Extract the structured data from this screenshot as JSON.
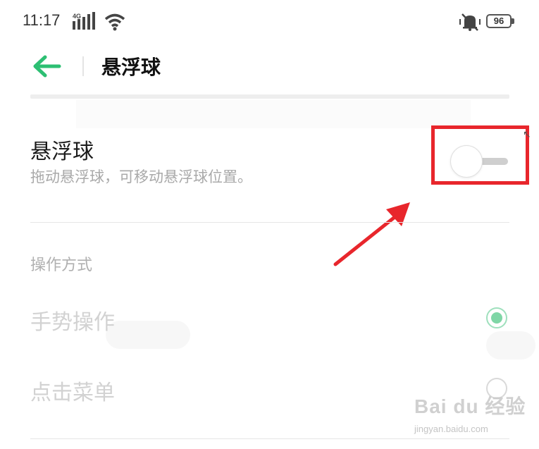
{
  "status_bar": {
    "time": "11:17",
    "network_icon": "4g-signal-icon",
    "wifi_icon": "wifi-icon",
    "mute_icon": "silent-mode-icon",
    "battery_level": "96"
  },
  "header": {
    "back_icon": "back-arrow-icon",
    "title": "悬浮球"
  },
  "floating_ball": {
    "title": "悬浮球",
    "description": "拖动悬浮球，可移动悬浮球位置。",
    "enabled": false
  },
  "operation": {
    "section_title": "操作方式",
    "options": [
      {
        "label": "手势操作",
        "selected": true
      },
      {
        "label": "点击菜单",
        "selected": false
      }
    ]
  },
  "watermark": {
    "brand": "Bai du 经验",
    "url": "jingyan.baidu.com"
  },
  "colors": {
    "accent_green": "#2dbf73",
    "highlight_red": "#e8262c",
    "radio_selected": "#7fd6a6"
  }
}
